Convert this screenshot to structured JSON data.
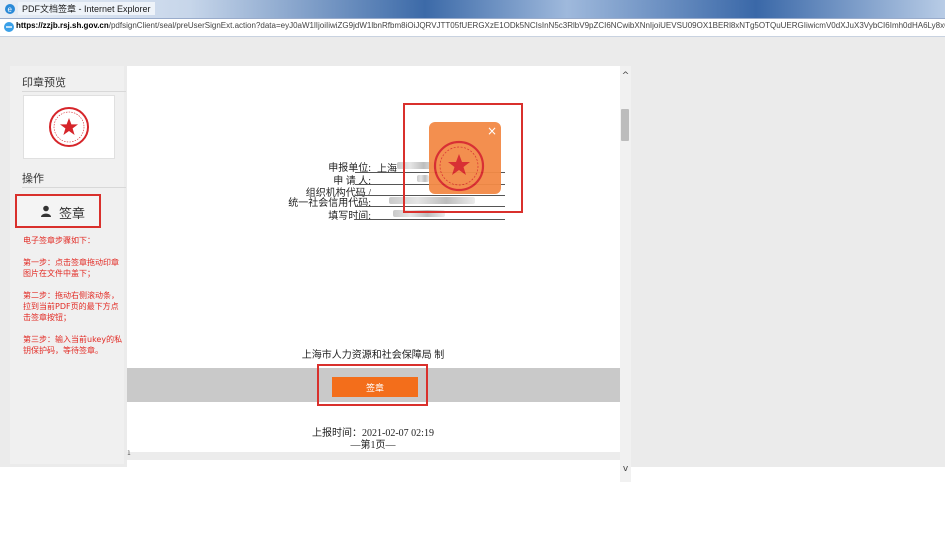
{
  "window": {
    "title": "PDF文档签章 - Internet Explorer",
    "url_host": "https://zzjb.rsj.sh.gov.cn",
    "url_path": "/pdfsignClient/seal/preUserSignExt.action?data=eyJ0aW1lIjoiIiwiZG9jdW1lbnRfbm8iOiJQRVJTT05fUERGXzE1ODk5NCIsInN5c3RlbV9pZCI6NCwibXNnIjoiUEVSU09OX1BERl8xNTg5OTQuUERGIiwicmV0dXJuX3VybCI6Imh0dHA6Ly8xOTIuMTY4Ljc2LjEwL3Noer"
  },
  "sidebar": {
    "preview_title": "印章预览",
    "ops_title": "操作",
    "sign_label": "签章",
    "steps": [
      "电子签章步骤如下：",
      "第一步：点击签章拖动印章图片在文件中盖下；",
      "第二步：拖动右侧滚动条，拉到当前PDF页的最下方点击签章按钮；",
      "第三步：输入当前ukey的私钥保护码，等待签章。"
    ]
  },
  "document": {
    "fields": [
      {
        "label": "申报单位:",
        "value": "上海"
      },
      {
        "label": "申 请 人:",
        "value": ""
      },
      {
        "label": "组织机构代码 /",
        "value": ""
      },
      {
        "label": "统一社会信用代码:",
        "value": ""
      },
      {
        "label": "填写时间:",
        "value": ""
      }
    ],
    "issuer": "上海市人力资源和社会保障局 制",
    "sign_button": "签章",
    "report_time": "上报时间：2021-02-07 02:19",
    "page_label": "—第1页—",
    "page_number": "1"
  },
  "colors": {
    "accent_orange": "#f36e1b",
    "highlight_red": "#d9302c",
    "instructions_red": "#e22b25",
    "seal_red": "#d6252a"
  },
  "icons": {
    "browser": "ie-icon",
    "site": "lock-icon",
    "user": "user-icon",
    "close": "close-icon",
    "scroll_up": "chevron-up-icon",
    "scroll_down": "chevron-down-icon"
  },
  "scroll_labels": {
    "up": "^",
    "down": "v"
  },
  "close_glyph": "×"
}
